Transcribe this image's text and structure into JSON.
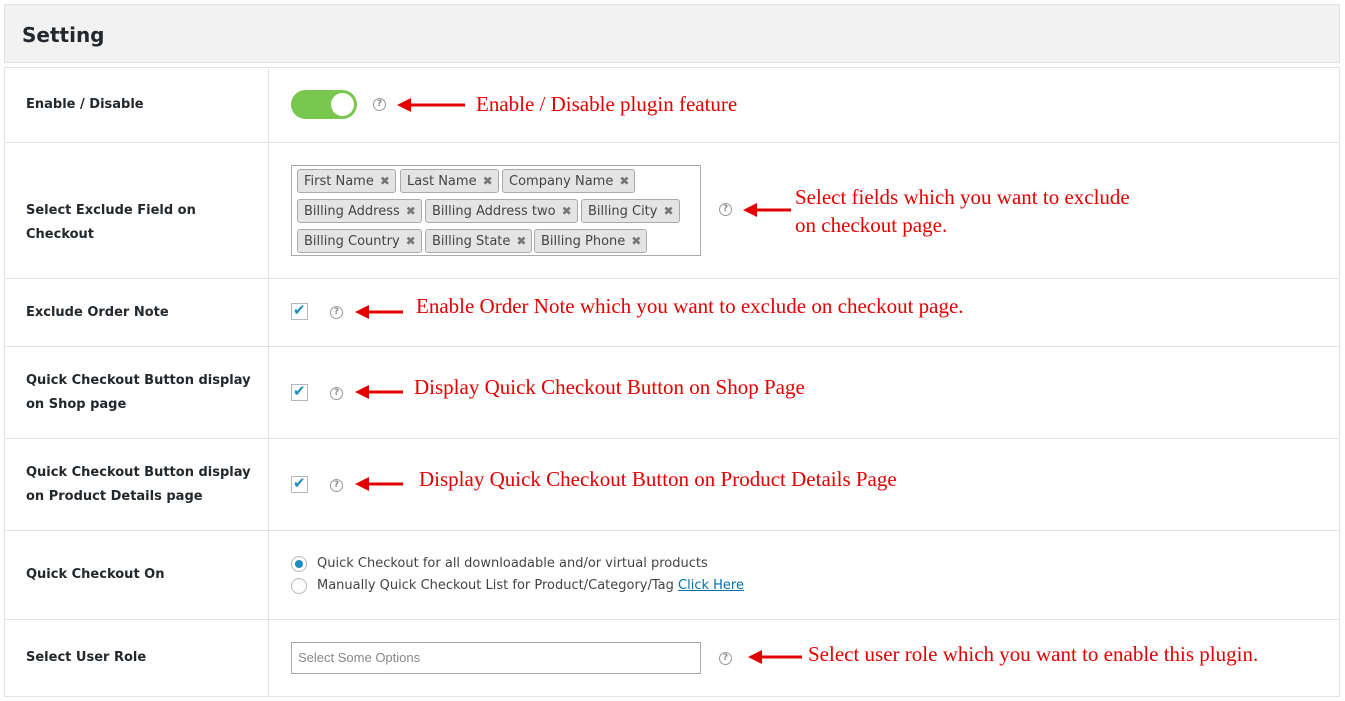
{
  "header": {
    "title": "Setting"
  },
  "rows": {
    "enable": {
      "label": "Enable / Disable",
      "toggle_on": true,
      "annotation": "Enable / Disable plugin feature"
    },
    "exclude_fields": {
      "label": "Select Exclude Field on Checkout",
      "tags": [
        "First Name",
        "Last Name",
        "Company Name",
        "Billing Address",
        "Billing Address two",
        "Billing City",
        "Billing Country",
        "Billing State",
        "Billing Phone"
      ],
      "tag_remove_glyph": "✖",
      "annotation_line1": "Select fields which you want to exclude",
      "annotation_line2": "on checkout page."
    },
    "order_note": {
      "label": "Exclude Order Note",
      "checked": true,
      "annotation": "Enable Order Note which you want to exclude on checkout page."
    },
    "shop_page": {
      "label_line1": "Quick Checkout Button display",
      "label_line2": "on Shop page",
      "checked": true,
      "annotation": "Display Quick Checkout Button on Shop Page"
    },
    "product_page": {
      "label_line1": "Quick Checkout Button display",
      "label_line2": "on Product Details page",
      "checked": true,
      "annotation": "Display Quick Checkout Button on Product Details Page"
    },
    "checkout_on": {
      "label": "Quick Checkout On",
      "option1": "Quick Checkout for all downloadable and/or virtual products",
      "option2": "Manually Quick Checkout List for Product/Category/Tag",
      "option2_link": "Click Here",
      "selected": "option1"
    },
    "user_role": {
      "label": "Select User Role",
      "placeholder": "Select Some Options",
      "annotation": "Select user role which you want to enable this plugin."
    }
  },
  "help_glyph": "?",
  "checkmark_glyph": "✔",
  "colors": {
    "toggle_on": "#7ac74f",
    "annotation": "#e00000",
    "checkbox_accent": "#1e8cbe",
    "link": "#0073aa"
  }
}
